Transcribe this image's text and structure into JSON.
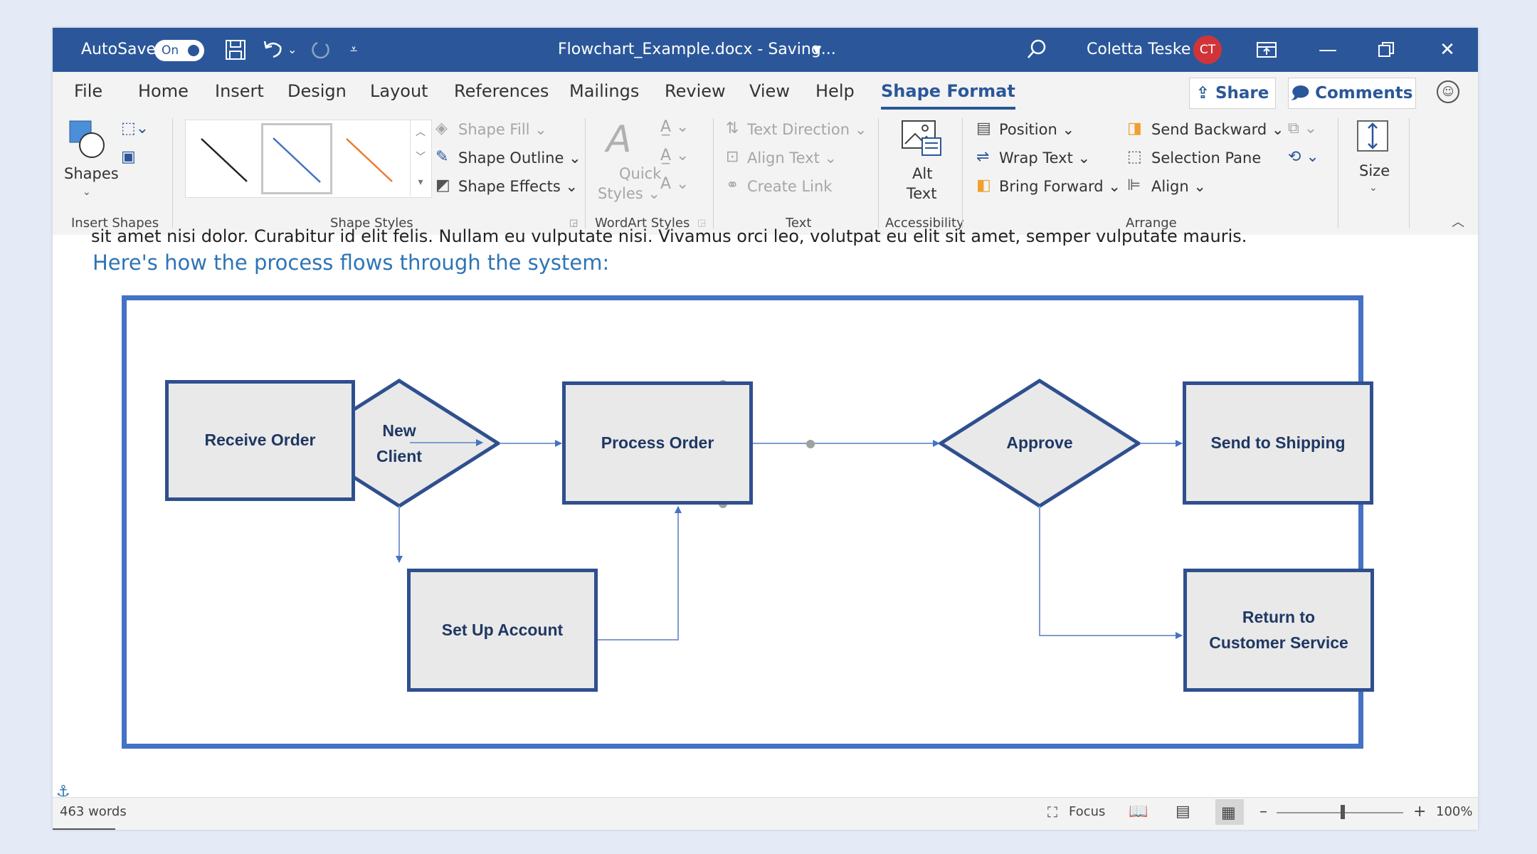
{
  "titlebar": {
    "autosave_label": "AutoSave",
    "autosave_state": "On",
    "title": "Flowchart_Example.docx  -  Saving...",
    "user_name": "Coletta Teske",
    "user_initials": "CT"
  },
  "menu": {
    "tabs": [
      "File",
      "Home",
      "Insert",
      "Design",
      "Layout",
      "References",
      "Mailings",
      "Review",
      "View",
      "Help",
      "Shape Format"
    ],
    "active_tab": "Shape Format",
    "share_label": "Share",
    "comments_label": "Comments"
  },
  "ribbon": {
    "insert_shapes": {
      "shapes_label": "Shapes",
      "group_label": "Insert Shapes"
    },
    "shape_styles": {
      "fill": "Shape Fill",
      "outline": "Shape Outline",
      "effects": "Shape Effects",
      "group_label": "Shape Styles"
    },
    "wordart_styles": {
      "quick_styles_line1": "Quick",
      "quick_styles_line2": "Styles",
      "group_label": "WordArt Styles"
    },
    "text": {
      "direction": "Text Direction",
      "align": "Align Text",
      "create_link": "Create Link",
      "group_label": "Text"
    },
    "accessibility": {
      "alt_line1": "Alt",
      "alt_line2": "Text",
      "group_label": "Accessibility"
    },
    "arrange": {
      "position": "Position",
      "wrap_text": "Wrap Text",
      "bring_forward": "Bring Forward",
      "send_backward": "Send Backward",
      "selection_pane": "Selection Pane",
      "align": "Align",
      "group_label": "Arrange"
    },
    "size": {
      "label": "Size"
    }
  },
  "document": {
    "partial_line": "sit amet nisi dolor. Curabitur id elit felis. Nullam eu vulputate nisi. Vivamus orci leo, volutpat eu elit sit amet, semper vulputate mauris.",
    "heading": "Here's how the process flows through the system:",
    "flowchart": {
      "receive_order": "Receive Order",
      "new_client_line1": "New",
      "new_client_line2": "Client",
      "process_order": "Process Order",
      "approve": "Approve",
      "send_to_shipping": "Send to Shipping",
      "set_up_account": "Set Up Account",
      "return_line1": "Return to",
      "return_line2": "Customer Service"
    }
  },
  "status": {
    "words": "463 words",
    "focus": "Focus",
    "zoom": "100%"
  },
  "colors": {
    "titlebar": "#2b579a",
    "accent": "#2b579a",
    "frame_border": "#4472c4",
    "shape_border": "#2f4f8f",
    "shape_fill": "#e9e9e9",
    "heading": "#2e74b5",
    "avatar": "#d13438"
  }
}
